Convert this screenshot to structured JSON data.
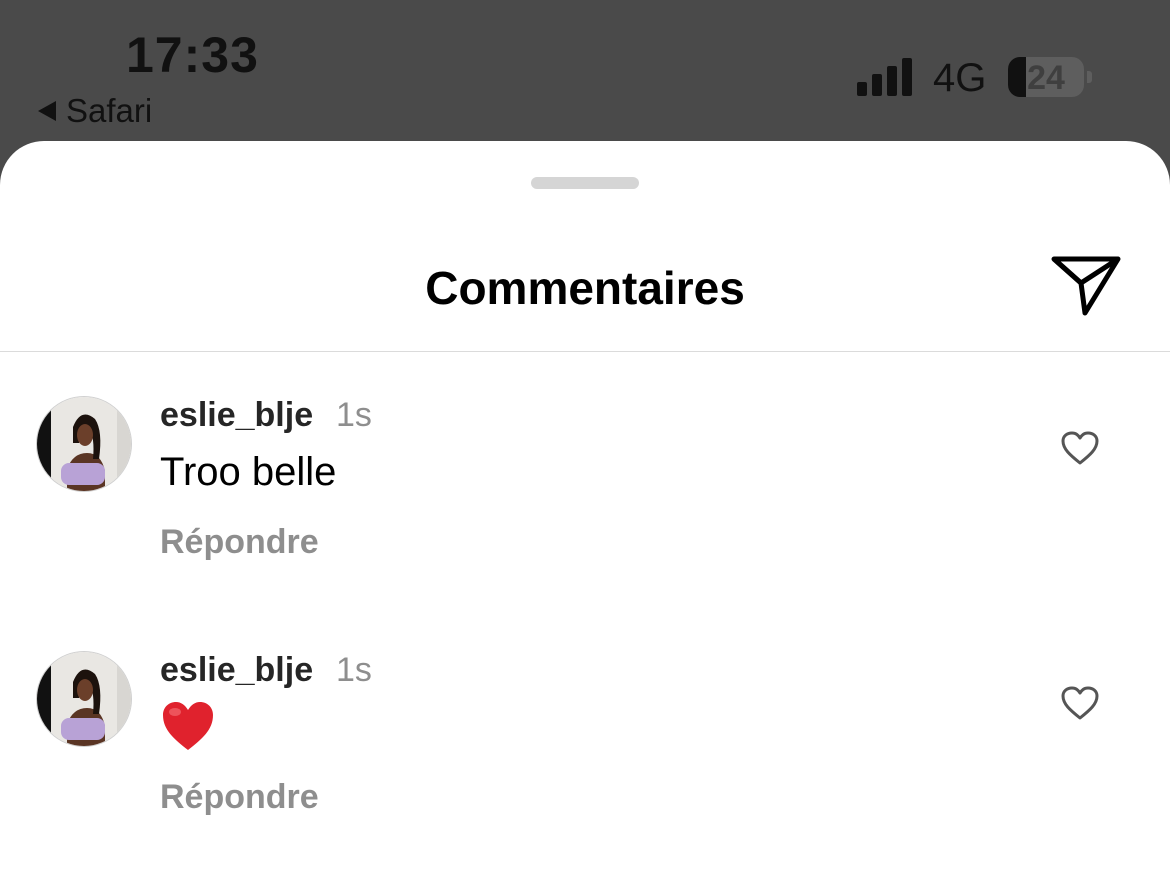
{
  "status_bar": {
    "time": "17:33",
    "back_app": "Safari",
    "network": "4G",
    "battery": "24",
    "signal_bars": 4
  },
  "sheet": {
    "title": "Commentaires",
    "share_icon": "paper-plane-icon"
  },
  "comments": [
    {
      "username": "eslie_blje",
      "ago": "1s",
      "text": "Troo belle",
      "reply_label": "Répondre",
      "like_icon": "heart-outline-icon"
    },
    {
      "username": "eslie_blje",
      "ago": "1s",
      "text": "",
      "emoji": "red-heart-emoji",
      "reply_label": "Répondre",
      "like_icon": "heart-outline-icon"
    }
  ],
  "colors": {
    "backdrop": "#4a4a4a",
    "muted_text": "#8e8e8e",
    "emoji_red": "#e0222d"
  }
}
